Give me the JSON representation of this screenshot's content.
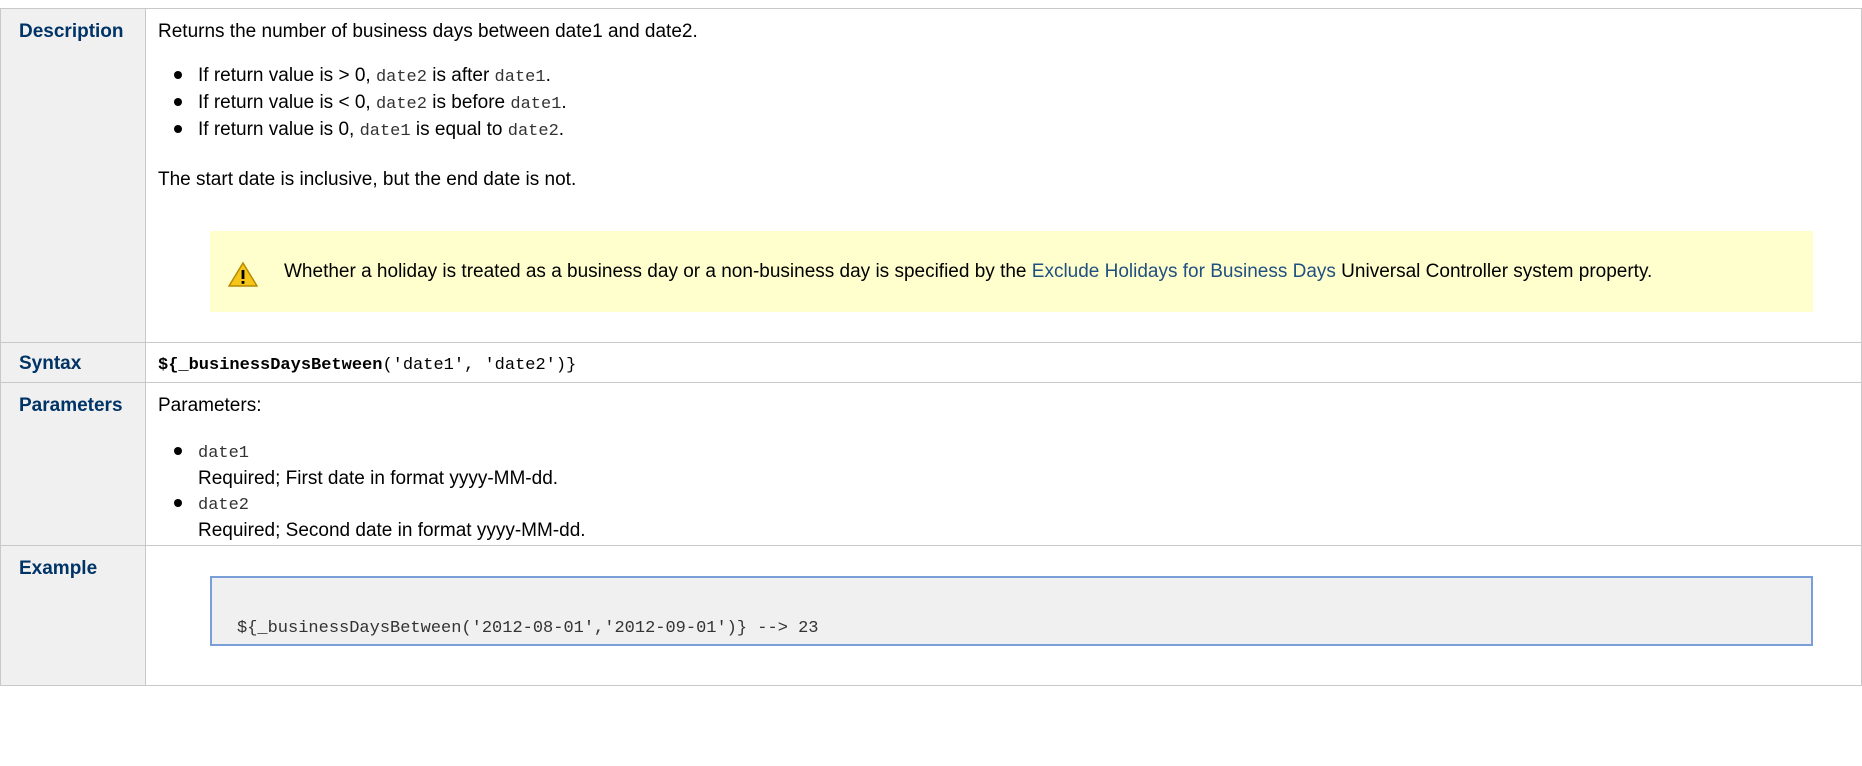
{
  "rows": {
    "description": {
      "label": "Description",
      "intro": "Returns the number of business days between date1 and date2.",
      "bullets": [
        {
          "pre": "If return value is > 0, ",
          "code1": "date2",
          "mid": " is after ",
          "code2": "date1",
          "post": "."
        },
        {
          "pre": "If return value is < 0, ",
          "code1": "date2",
          "mid": " is before ",
          "code2": "date1",
          "post": "."
        },
        {
          "pre": "If return value is 0, ",
          "code1": "date1",
          "mid": " is equal to ",
          "code2": "date2",
          "post": "."
        }
      ],
      "note": "The start date is inclusive, but the end date is not.",
      "warning": {
        "icon": "warning-icon",
        "pre": "Whether a holiday is treated as a business day or a non-business day is specified by the ",
        "link": "Exclude Holidays for Business Days",
        "post": " Universal Controller system property."
      }
    },
    "syntax": {
      "label": "Syntax",
      "open": "${",
      "func": "_businessDaysBetween",
      "args": "('date1', 'date2')}"
    },
    "parameters": {
      "label": "Parameters",
      "intro": "Parameters:",
      "items": [
        {
          "name": "date1",
          "desc": "Required; First date in format yyyy-MM-dd."
        },
        {
          "name": "date2",
          "desc": "Required; Second date in format yyyy-MM-dd."
        }
      ]
    },
    "example": {
      "label": "Example",
      "code": "${_businessDaysBetween('2012-08-01','2012-09-01')} --> 23"
    }
  }
}
